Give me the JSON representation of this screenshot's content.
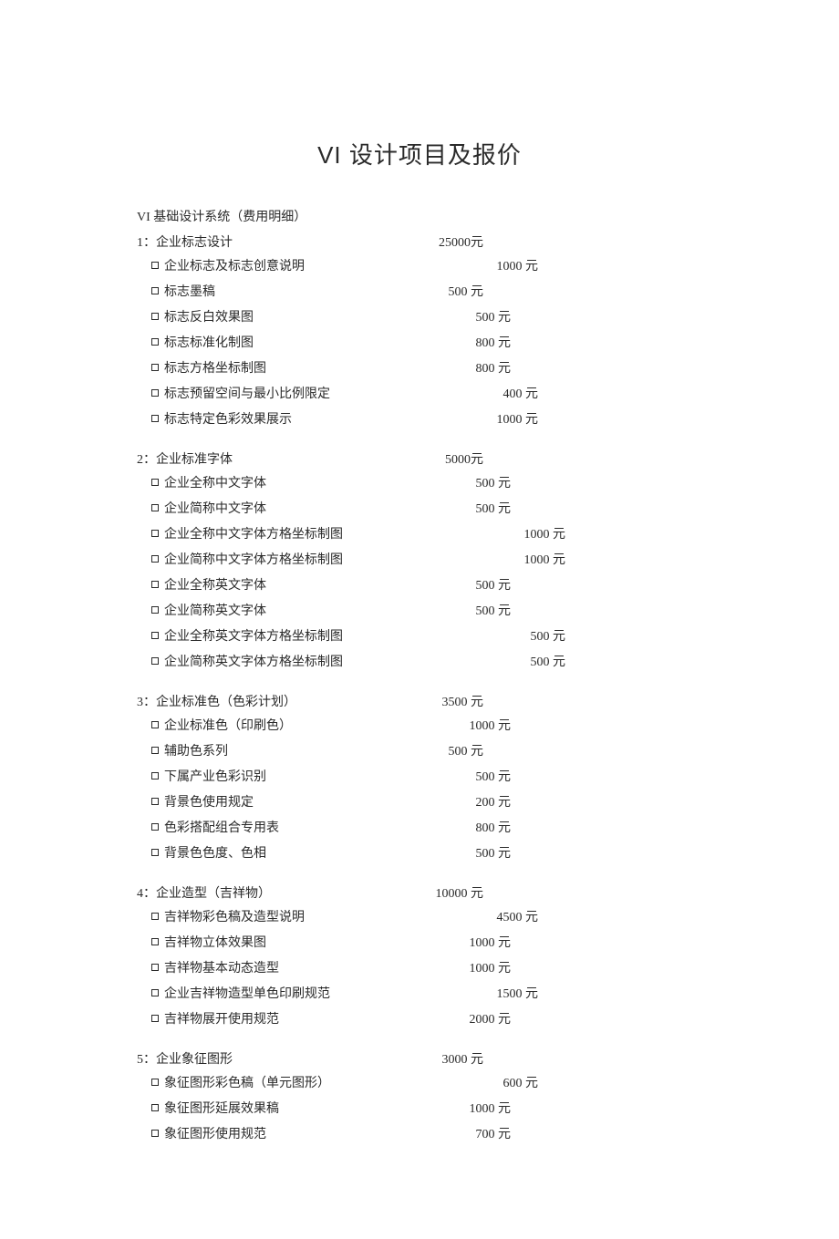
{
  "title": "VI 设计项目及报价",
  "subtitle": "VI 基础设计系统（费用明细）",
  "sections": [
    {
      "heading": "1：企业标志设计",
      "price": "25000元",
      "items": [
        {
          "label": "企业标志及标志创意说明",
          "price": "1000 元",
          "w": "row-w4"
        },
        {
          "label": "标志墨稿",
          "price": "500 元",
          "w": "row-w2"
        },
        {
          "label": "标志反白效果图",
          "price": "500 元",
          "w": "row-w3"
        },
        {
          "label": "标志标准化制图",
          "price": "800 元",
          "w": "row-w3"
        },
        {
          "label": "标志方格坐标制图",
          "price": "800 元",
          "w": "row-w3"
        },
        {
          "label": "标志预留空间与最小比例限定",
          "price": "400 元",
          "w": "row-w4"
        },
        {
          "label": "标志特定色彩效果展示",
          "price": "1000 元",
          "w": "row-w4"
        }
      ]
    },
    {
      "heading": "2：企业标准字体",
      "price": "5000元",
      "items": [
        {
          "label": "企业全称中文字体",
          "price": "500 元",
          "w": "row-w3"
        },
        {
          "label": "企业简称中文字体",
          "price": "500 元",
          "w": "row-w3"
        },
        {
          "label": "企业全称中文字体方格坐标制图",
          "price": "1000 元",
          "w": "row-w5"
        },
        {
          "label": "企业简称中文字体方格坐标制图",
          "price": "1000 元",
          "w": "row-w5"
        },
        {
          "label": "企业全称英文字体",
          "price": "500 元",
          "w": "row-w3"
        },
        {
          "label": "企业简称英文字体",
          "price": "500 元",
          "w": "row-w3"
        },
        {
          "label": "企业全称英文字体方格坐标制图",
          "price": "500 元",
          "w": "row-w5"
        },
        {
          "label": "企业简称英文字体方格坐标制图",
          "price": "500 元",
          "w": "row-w5"
        }
      ]
    },
    {
      "heading": "3：企业标准色（色彩计划）",
      "price": "3500 元",
      "items": [
        {
          "label": "企业标准色（印刷色）",
          "price": "1000 元",
          "w": "row-w3"
        },
        {
          "label": "辅助色系列",
          "price": "500 元",
          "w": "row-w2"
        },
        {
          "label": "下属产业色彩识别",
          "price": "500 元",
          "w": "row-w3"
        },
        {
          "label": "背景色使用规定",
          "price": "200 元",
          "w": "row-w3"
        },
        {
          "label": "色彩搭配组合专用表",
          "price": "800 元",
          "w": "row-w3"
        },
        {
          "label": "背景色色度、色相",
          "price": "500 元",
          "w": "row-w3"
        }
      ]
    },
    {
      "heading": "4：企业造型（吉祥物）",
      "price": "10000 元",
      "items": [
        {
          "label": "吉祥物彩色稿及造型说明",
          "price": "4500 元",
          "w": "row-w4"
        },
        {
          "label": "吉祥物立体效果图",
          "price": "1000 元",
          "w": "row-w3"
        },
        {
          "label": "吉祥物基本动态造型",
          "price": "1000 元",
          "w": "row-w3"
        },
        {
          "label": "企业吉祥物造型单色印刷规范",
          "price": "1500 元",
          "w": "row-w4"
        },
        {
          "label": "吉祥物展开使用规范",
          "price": "2000 元",
          "w": "row-w3"
        }
      ]
    },
    {
      "heading": "5：企业象征图形",
      "price": "3000 元",
      "items": [
        {
          "label": "象征图形彩色稿（单元图形）",
          "price": "600 元",
          "w": "row-w4"
        },
        {
          "label": "象征图形延展效果稿",
          "price": "1000 元",
          "w": "row-w3"
        },
        {
          "label": "象征图形使用规范",
          "price": "700 元",
          "w": "row-w3"
        }
      ]
    }
  ]
}
